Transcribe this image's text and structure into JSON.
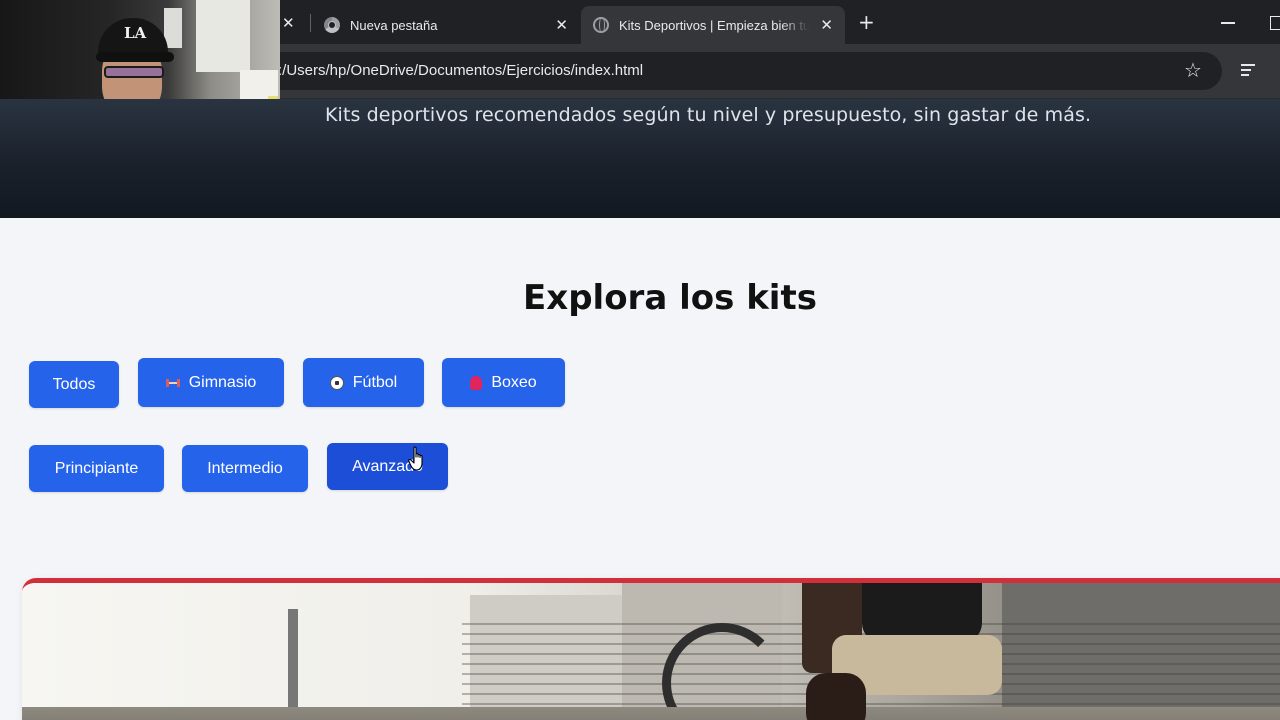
{
  "browser": {
    "tabs": [
      {
        "title": "Nueva pestaña"
      },
      {
        "title": "Kits Deportivos | Empieza bien tu e"
      }
    ],
    "url": "C:/Users/hp/OneDrive/Documentos/Ejercicios/index.html",
    "url_visible": ":/Users/hp/OneDrive/Documentos/Ejercicios/index.html"
  },
  "webcam": {
    "cap_logo": "LA"
  },
  "hero": {
    "subtitle": "Kits deportivos recomendados según tu nivel y presupuesto, sin gastar de más."
  },
  "section": {
    "title": "Explora los kits"
  },
  "filters": {
    "sport": [
      {
        "label": "Todos"
      },
      {
        "label": "Gimnasio",
        "icon": "dumbbell-icon"
      },
      {
        "label": "Fútbol",
        "icon": "soccer-ball-icon"
      },
      {
        "label": "Boxeo",
        "icon": "boxing-glove-icon"
      }
    ],
    "level": [
      {
        "label": "Principiante"
      },
      {
        "label": "Intermedio"
      },
      {
        "label": "Avanzado",
        "state": "hovered"
      }
    ]
  },
  "colors": {
    "button": "#2563eb",
    "button_hover": "#1d4ed8",
    "card_accent": "#d32f3a",
    "hero_bg": "#1a212b",
    "page_bg": "#f3f5f8"
  }
}
